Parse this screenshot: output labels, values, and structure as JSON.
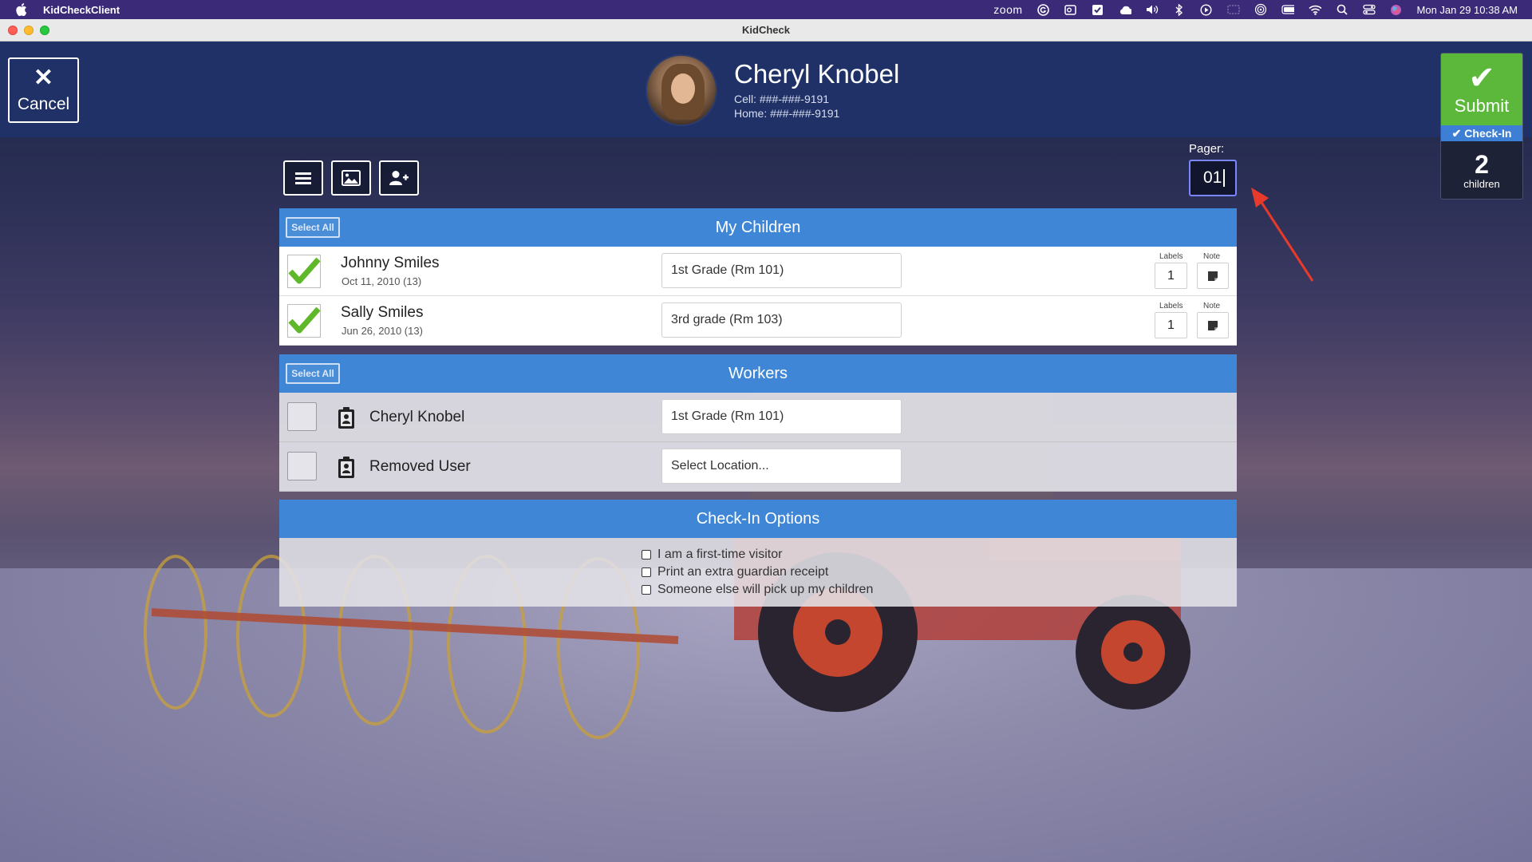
{
  "menubar": {
    "app_name": "KidCheckClient",
    "zoom_label": "zoom",
    "datetime": "Mon Jan 29  10:38 AM"
  },
  "window": {
    "title": "KidCheck"
  },
  "header": {
    "cancel_label": "Cancel",
    "guardian_name": "Cheryl Knobel",
    "cell_phone": "Cell: ###-###-9191",
    "home_phone": "Home: ###-###-9191",
    "submit_label": "Submit",
    "checkin_label": "Check-In",
    "children_count": "2",
    "children_unit": "children"
  },
  "pager": {
    "label": "Pager:",
    "value": "01"
  },
  "toolbar": {
    "icons": [
      "menu-icon",
      "image-icon",
      "add-user-icon"
    ]
  },
  "my_children": {
    "title": "My Children",
    "select_all_label": "Select All",
    "labels_header": "Labels",
    "note_header": "Note",
    "rows": [
      {
        "name": "Johnny Smiles",
        "dob": "Oct 11, 2010 (13)",
        "room": "1st Grade (Rm 101)",
        "labels": "1",
        "checked": true
      },
      {
        "name": "Sally Smiles",
        "dob": "Jun 26, 2010 (13)",
        "room": "3rd grade (Rm 103)",
        "labels": "1",
        "checked": true
      }
    ]
  },
  "workers": {
    "title": "Workers",
    "select_all_label": "Select All",
    "rows": [
      {
        "name": "Cheryl Knobel",
        "room": "1st Grade (Rm 101)",
        "checked": false
      },
      {
        "name": "Removed User",
        "room": "Select Location...",
        "checked": false
      }
    ]
  },
  "options": {
    "title": "Check-In Options",
    "items": [
      "I am a first-time visitor",
      "Print an extra guardian receipt",
      "Someone else will pick up my children"
    ]
  },
  "colors": {
    "header_bg": "#1f3166",
    "section_blue": "#3f87d6",
    "submit_green": "#5bb83a",
    "check_green": "#5fb82a",
    "annotation_red": "#e83a2a"
  }
}
